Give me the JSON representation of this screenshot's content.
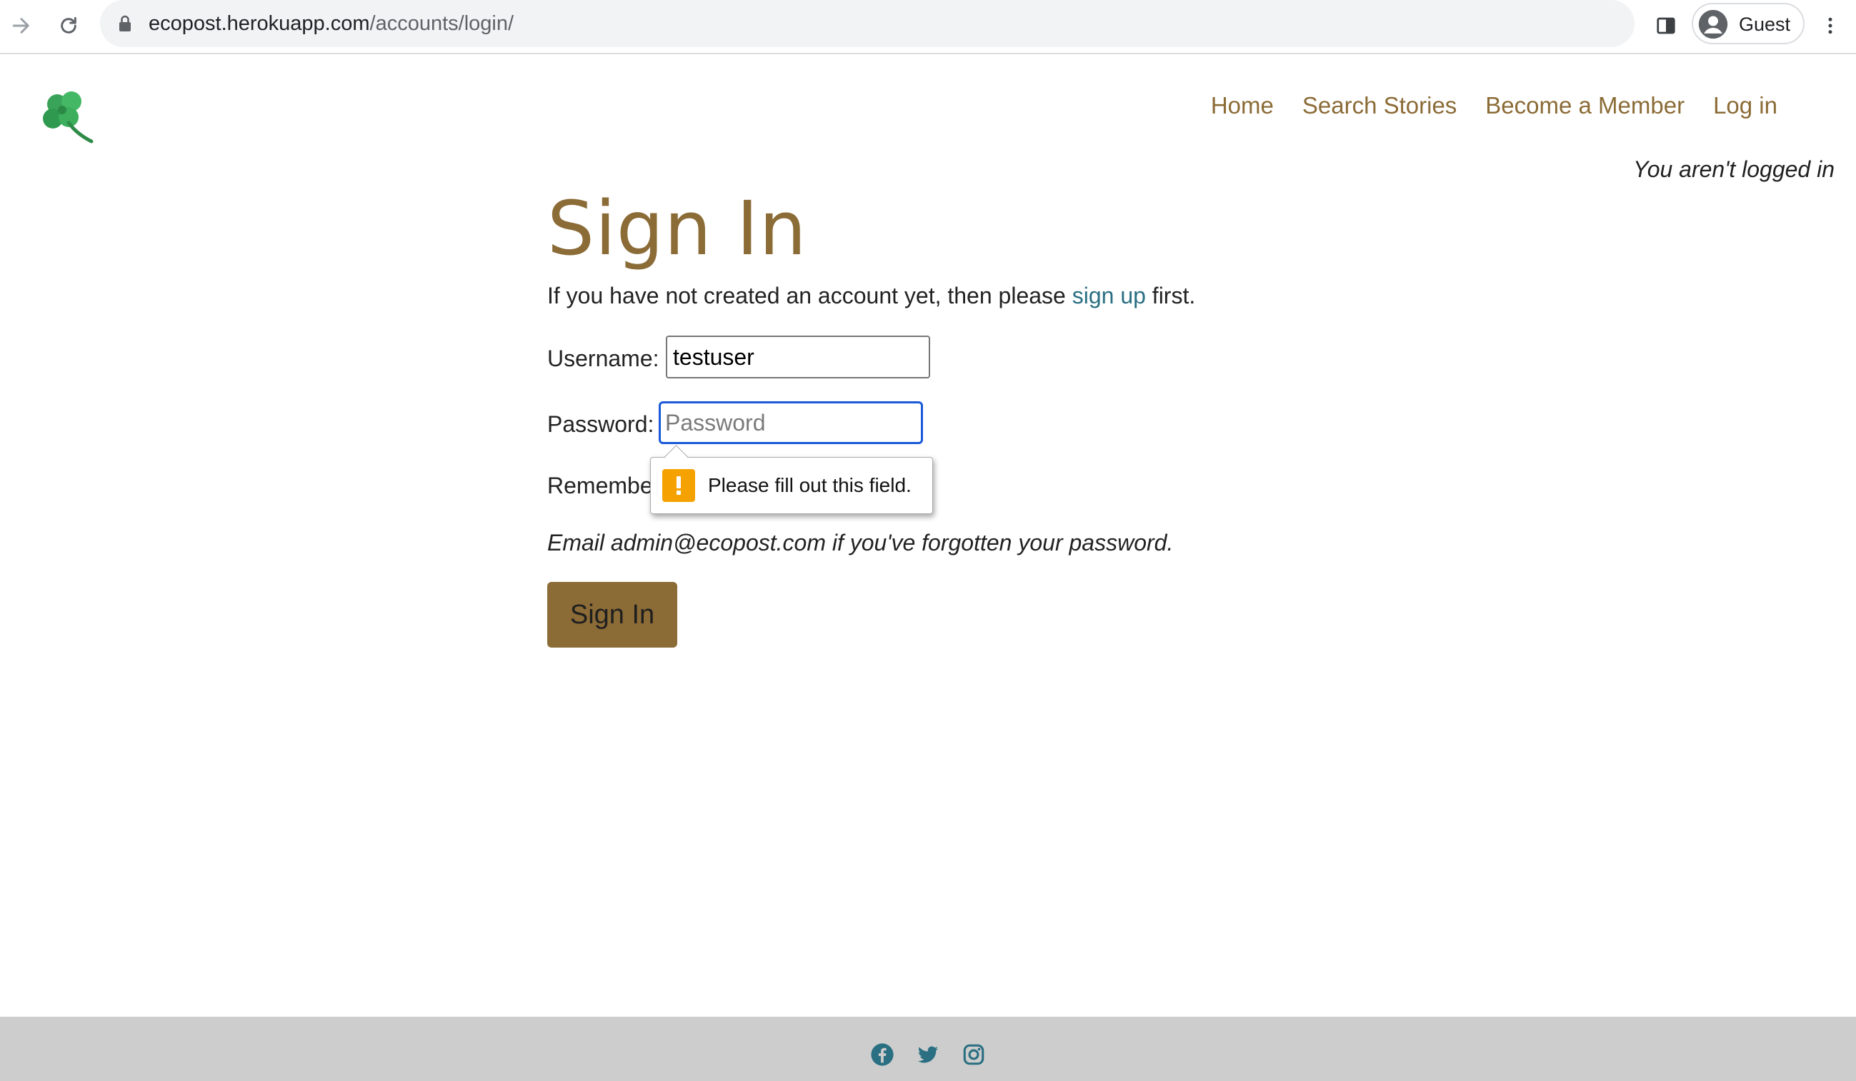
{
  "browser": {
    "url_host": "ecopost.herokuapp.com",
    "url_path": "/accounts/login/",
    "profile_name": "Guest"
  },
  "header": {
    "nav": [
      "Home",
      "Search Stories",
      "Become a Member",
      "Log in"
    ],
    "login_status": "You aren't logged in"
  },
  "main": {
    "title": "Sign In",
    "intro_before": "If you have not created an account yet, then please ",
    "intro_link": "sign up",
    "intro_after": " first.",
    "username_label": "Username:",
    "username_value": "testuser",
    "password_label": "Password:",
    "password_placeholder": "Password",
    "remember_label": "Remembe",
    "forgot_text": "Email admin@ecopost.com if you've forgotten your password.",
    "signin_button": "Sign In"
  },
  "tooltip": {
    "message": "Please fill out this field."
  },
  "footer": {
    "social_icons": [
      "facebook-icon",
      "twitter-icon",
      "instagram-icon"
    ]
  },
  "colors": {
    "brand": "#8b6b36",
    "link": "#2a6f82",
    "focus": "#1a5ad7",
    "warning": "#f5a200",
    "footer_bg": "#cdcdcd"
  }
}
